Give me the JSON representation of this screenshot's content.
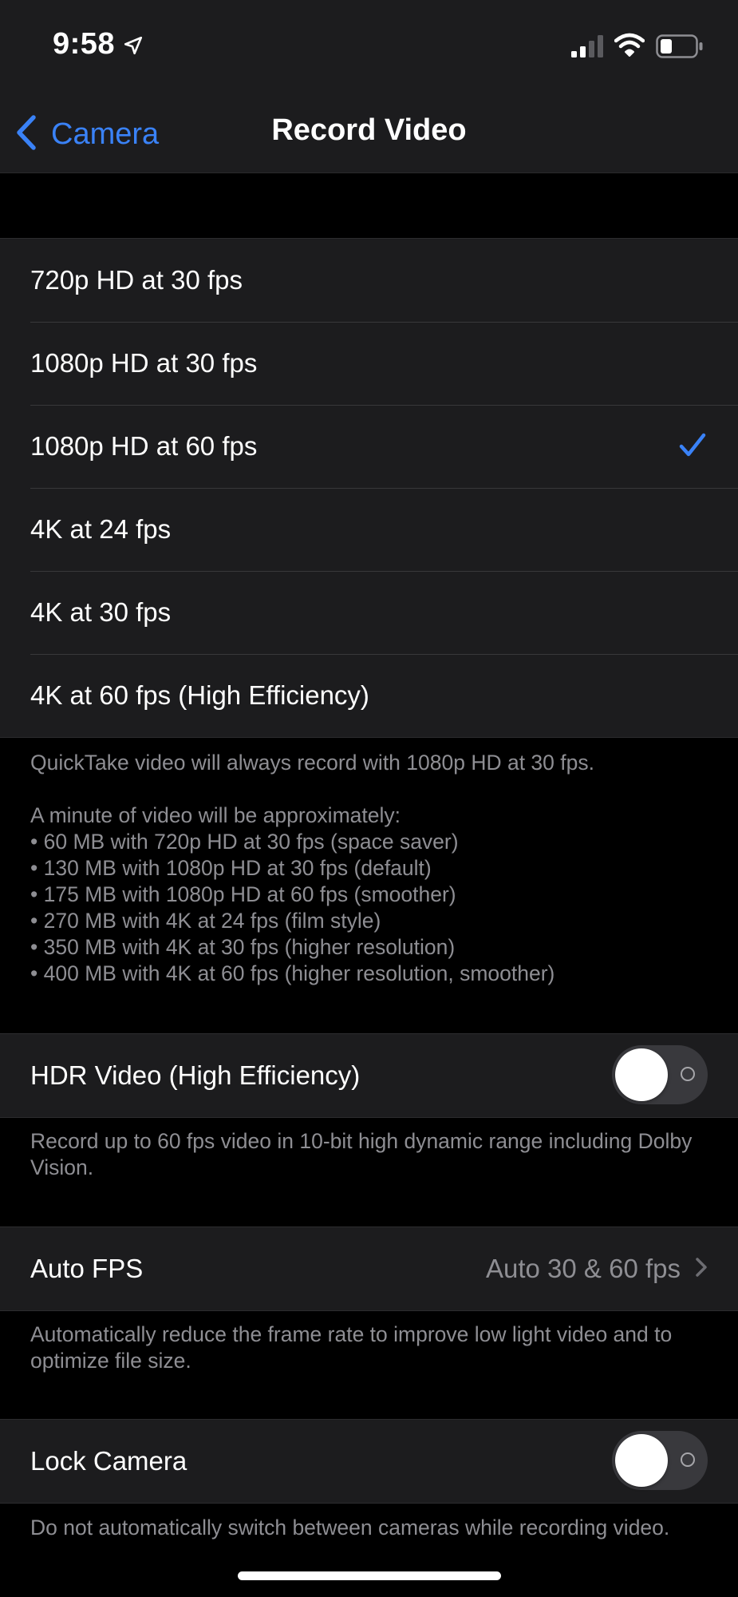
{
  "status_bar": {
    "time": "9:58"
  },
  "nav": {
    "back_label": "Camera",
    "title": "Record Video"
  },
  "formats": {
    "options": [
      {
        "label": "720p HD at 30 fps",
        "selected": false
      },
      {
        "label": "1080p HD at 30 fps",
        "selected": false
      },
      {
        "label": "1080p HD at 60 fps",
        "selected": true
      },
      {
        "label": "4K at 24 fps",
        "selected": false
      },
      {
        "label": "4K at 30 fps",
        "selected": false
      },
      {
        "label": "4K at 60 fps (High Efficiency)",
        "selected": false
      }
    ],
    "footer": {
      "quicktake": "QuickTake video will always record with 1080p HD at 30 fps.",
      "minute_intro": "A minute of video will be approximately:",
      "sizes": [
        "• 60 MB with 720p HD at 30 fps (space saver)",
        "• 130 MB with 1080p HD at 30 fps (default)",
        "• 175 MB with 1080p HD at 60 fps (smoother)",
        "• 270 MB with 4K at 24 fps (film style)",
        "• 350 MB with 4K at 30 fps (higher resolution)",
        "• 400 MB with 4K at 60 fps (higher resolution, smoother)"
      ]
    }
  },
  "hdr": {
    "label": "HDR Video (High Efficiency)",
    "enabled": false,
    "footer": "Record up to 60 fps video in 10-bit high dynamic range including Dolby Vision."
  },
  "auto_fps": {
    "label": "Auto FPS",
    "value": "Auto 30 & 60 fps",
    "footer": "Automatically reduce the frame rate to improve low light video and to optimize file size."
  },
  "lock_camera": {
    "label": "Lock Camera",
    "enabled": false,
    "footer": "Do not automatically switch between cameras while recording video."
  },
  "colors": {
    "accent": "#3a82f7",
    "group_background": "#1c1c1e",
    "page_background": "#000000",
    "secondary_text": "#8e8e93"
  },
  "icons": {
    "back": "chevron-left-icon",
    "selected": "checkmark-icon",
    "disclosure": "chevron-right-icon"
  }
}
